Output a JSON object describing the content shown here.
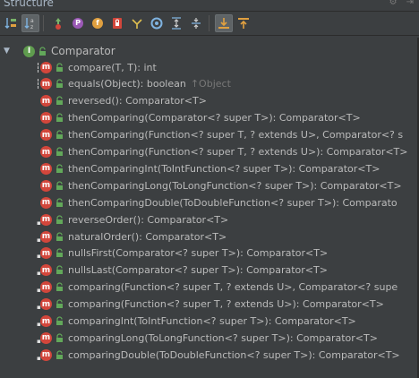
{
  "panel": {
    "title": "Structure"
  },
  "toolbar": {
    "buttons": [
      {
        "icon": "sort-by-visibility-icon",
        "active": false
      },
      {
        "icon": "sort-alphabetically-icon",
        "active": true
      },
      {
        "icon": "show-inherited-icon",
        "active": false
      },
      {
        "icon": "show-properties-icon",
        "active": false
      },
      {
        "icon": "show-fields-icon",
        "active": false
      },
      {
        "icon": "show-non-public-icon",
        "active": false
      },
      {
        "icon": "show-lambdas-icon",
        "active": false
      },
      {
        "icon": "show-anonymous-icon",
        "active": false
      },
      {
        "icon": "expand-all-icon",
        "active": false
      },
      {
        "icon": "collapse-all-icon",
        "active": false
      },
      {
        "icon": "autoscroll-to-source-icon",
        "active": true
      },
      {
        "icon": "autoscroll-from-source-icon",
        "active": false
      }
    ],
    "circle_labels": {
      "property": "P",
      "field": "f"
    }
  },
  "tree": {
    "root": {
      "label": "Comparator",
      "icon": "interface-icon",
      "icon_letter": "I"
    },
    "items": [
      {
        "label": "compare(T, T): int",
        "kind": "abstract"
      },
      {
        "label": "equals(Object): boolean",
        "inherited": "↑Object",
        "kind": "abstract"
      },
      {
        "label": "reversed(): Comparator<T>",
        "kind": "default"
      },
      {
        "label": "thenComparing(Comparator<? super T>): Comparator<T>",
        "kind": "default"
      },
      {
        "label": "thenComparing(Function<? super T, ? extends U>, Comparator<? s",
        "kind": "default"
      },
      {
        "label": "thenComparing(Function<? super T, ? extends U>): Comparator<T>",
        "kind": "default"
      },
      {
        "label": "thenComparingInt(ToIntFunction<? super T>): Comparator<T>",
        "kind": "default"
      },
      {
        "label": "thenComparingLong(ToLongFunction<? super T>): Comparator<T>",
        "kind": "default"
      },
      {
        "label": "thenComparingDouble(ToDoubleFunction<? super T>): Comparato",
        "kind": "default"
      },
      {
        "label": "reverseOrder(): Comparator<T>",
        "kind": "static"
      },
      {
        "label": "naturalOrder(): Comparator<T>",
        "kind": "static"
      },
      {
        "label": "nullsFirst(Comparator<? super T>): Comparator<T>",
        "kind": "static"
      },
      {
        "label": "nullsLast(Comparator<? super T>): Comparator<T>",
        "kind": "static"
      },
      {
        "label": "comparing(Function<? super T, ? extends U>, Comparator<? supe",
        "kind": "static"
      },
      {
        "label": "comparing(Function<? super T, ? extends U>): Comparator<T>",
        "kind": "static"
      },
      {
        "label": "comparingInt(ToIntFunction<? super T>): Comparator<T>",
        "kind": "static"
      },
      {
        "label": "comparingLong(ToLongFunction<? super T>): Comparator<T>",
        "kind": "static"
      },
      {
        "label": "comparingDouble(ToDoubleFunction<? super T>): Comparator<T>",
        "kind": "static"
      }
    ],
    "method_icon_letter": "m"
  },
  "colors": {
    "method": "#d2463b",
    "interface": "#5f9c4e",
    "lock": "#62a85a",
    "text": "#bbbbbb",
    "inherited_text": "#787878",
    "background": "#3c3f41"
  }
}
